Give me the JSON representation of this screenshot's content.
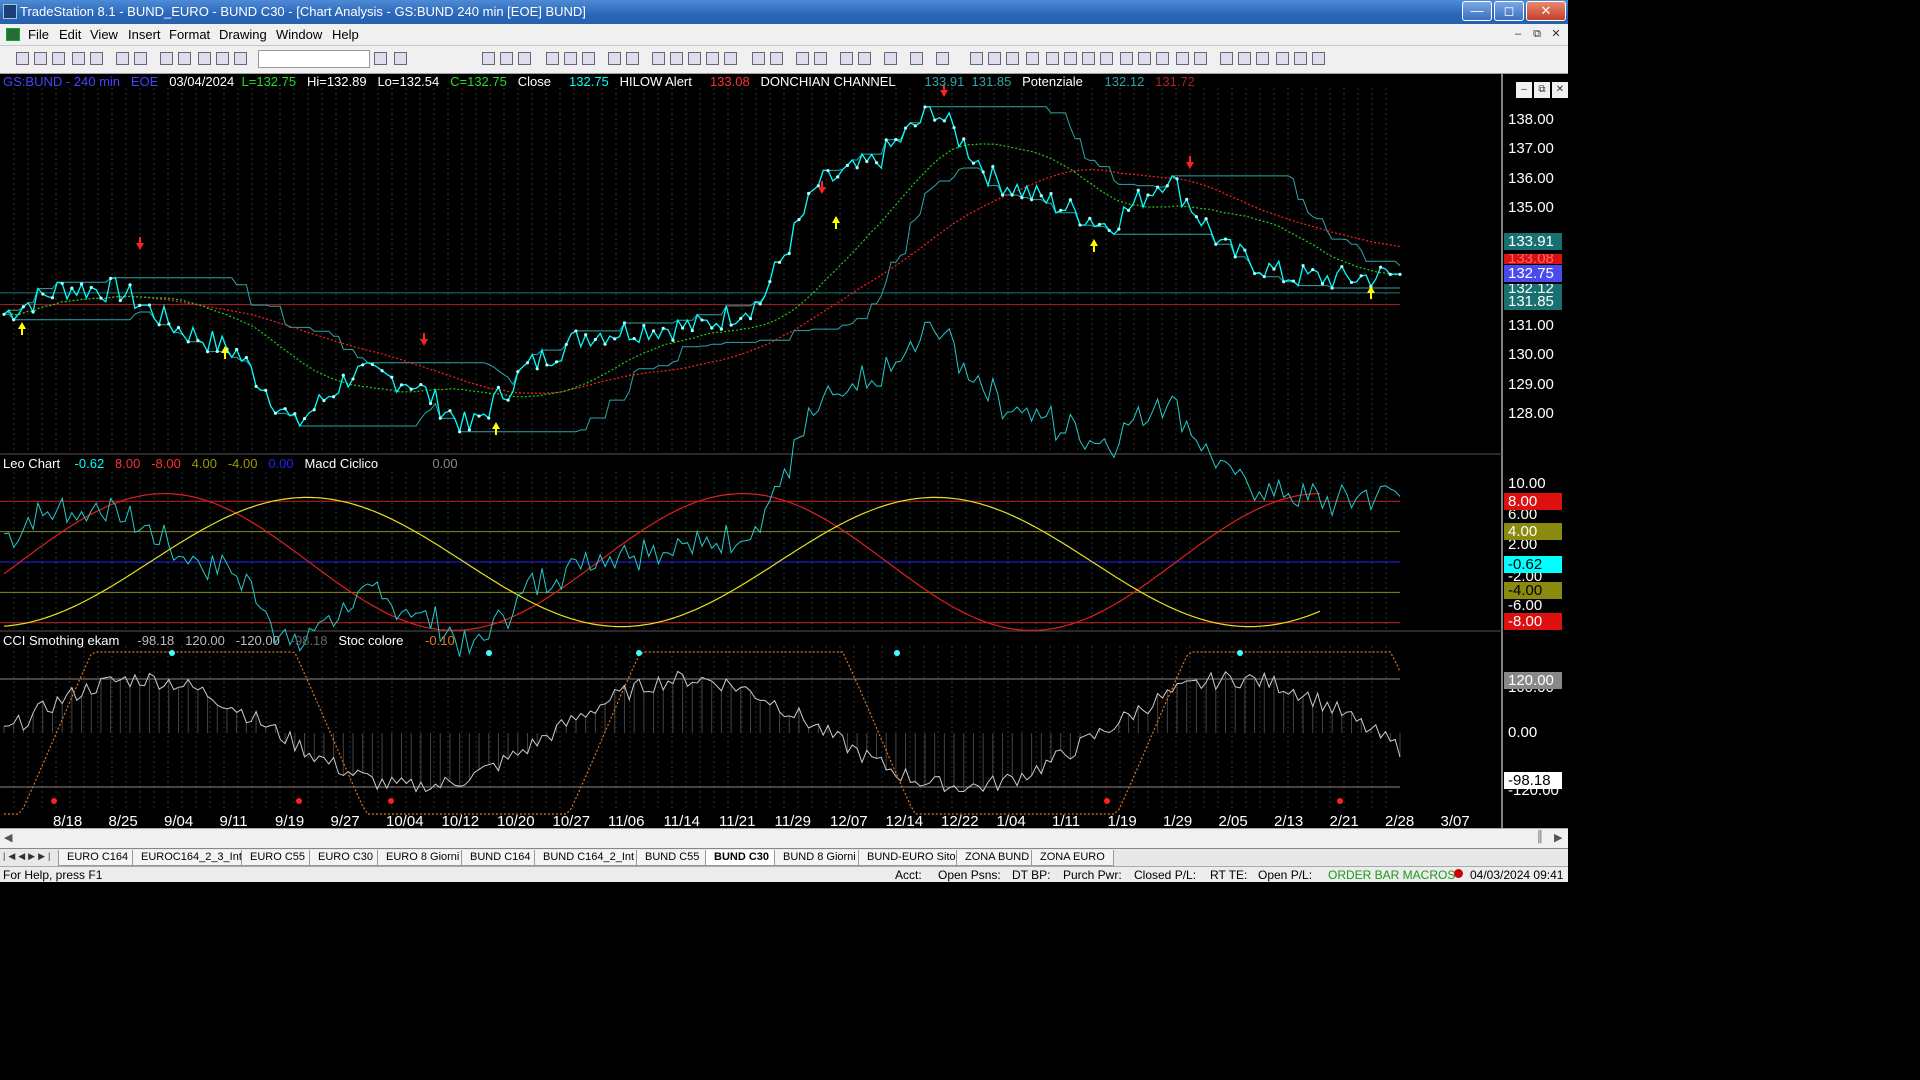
{
  "window": {
    "title": "TradeStation 8.1 - BUND_EURO - BUND  C30 - [Chart Analysis - GS:BUND  240 min  [EOE] BUND]"
  },
  "menu": [
    "File",
    "Edit",
    "View",
    "Insert",
    "Format",
    "Drawing",
    "Window",
    "Help"
  ],
  "header": {
    "symbol": "GS:BUND - 240 min",
    "session": "EOE",
    "date": "03/04/2024",
    "last": "L=132.75",
    "high": "Hi=132.89",
    "low": "Lo=132.54",
    "close": "C=132.75",
    "close_label": "Close",
    "close_val": "132.75",
    "hilow_label": "HILOW Alert",
    "hilow_val": "133.08",
    "donchian_label": "DONCHIAN CHANNEL",
    "donchian_val1": "133.91",
    "donchian_val2": "131.85",
    "pot_label": "Potenziale",
    "pot_val1": "132.12",
    "pot_val2": "131.72"
  },
  "leo": {
    "label": "Leo Chart",
    "v1": "-0.62",
    "v2": "8.00",
    "v3": "-8.00",
    "v4": "4.00",
    "v5": "-4.00",
    "v6": "0.00",
    "macd_label": "Macd Ciclico",
    "macd_val": "0.00"
  },
  "cci": {
    "label": "CCI Smothing ekam",
    "v1": "-98.18",
    "v2": "120.00",
    "v3": "-120.00",
    "v4": "-98.18",
    "stoc_label": "Stoc colore",
    "stoc_val": "-0.10"
  },
  "price_axis": [
    "138.00",
    "137.00",
    "136.00",
    "135.00",
    "131.00",
    "130.00",
    "129.00",
    "128.00"
  ],
  "price_tags": {
    "donchian_hi": "133.91",
    "hilow": "133.08",
    "last": "132.75",
    "pot": "132.12",
    "donchian_lo": "131.85"
  },
  "leo_axis": [
    "10.00",
    "6.00",
    "2.00",
    "-2.00",
    "-6.00"
  ],
  "leo_tags": {
    "t8": "8.00",
    "t4": "4.00",
    "cur": "-0.62",
    "tm4": "-4.00",
    "tm8": "-8.00"
  },
  "cci_axis": [
    "100.00",
    "0.00",
    "-120.00"
  ],
  "cci_tags": {
    "t120": "120.00",
    "cur": "-98.18"
  },
  "dates": [
    "8/18",
    "8/25",
    "9/04",
    "9/11",
    "9/19",
    "9/27",
    "10/04",
    "10/12",
    "10/20",
    "10/27",
    "11/06",
    "11/14",
    "11/21",
    "11/29",
    "12/07",
    "12/14",
    "12/22",
    "1/04",
    "1/11",
    "1/19",
    "1/29",
    "2/05",
    "2/13",
    "2/21",
    "2/28",
    "3/07"
  ],
  "tabs": [
    "EURO C164",
    "EUROC164_2_3_Int",
    "EURO C55",
    "EURO C30",
    "EURO 8 Giorni",
    "BUND C164",
    "BUND C164_2_Int",
    "BUND C55",
    "BUND  C30",
    "BUND 8 Giorni",
    "BUND-EURO Sito",
    "ZONA BUND",
    "ZONA EURO"
  ],
  "active_tab": "BUND  C30",
  "status": {
    "help": "For Help, press F1",
    "acct": "Acct:",
    "open_psns": "Open Psns:",
    "dt_bp": "DT BP:",
    "purch": "Purch Pwr:",
    "closed_pl": "Closed P/L:",
    "rt_te": "RT TE:",
    "open_pl": "Open P/L:",
    "macros": "ORDER BAR  MACROS",
    "clock": "04/03/2024 09:41"
  },
  "colors": {
    "bg": "#000000",
    "close_line": "#00ffff",
    "donchian": "#2aa8a8",
    "red_ma": "#ff2020",
    "green_ma": "#22cc22",
    "yellow": "#ffff00",
    "grey": "#bbbbbb"
  },
  "chart_data": {
    "type": "line",
    "title": "GS:BUND - 240 min",
    "x": [
      "8/18",
      "8/25",
      "9/04",
      "9/11",
      "9/19",
      "9/27",
      "10/04",
      "10/12",
      "10/20",
      "10/27",
      "11/06",
      "11/14",
      "11/21",
      "11/29",
      "12/07",
      "12/14",
      "12/22",
      "1/04",
      "1/11",
      "1/19",
      "1/29",
      "2/05",
      "2/13",
      "2/21",
      "2/28"
    ],
    "series": [
      {
        "name": "Close",
        "values": [
          131.4,
          132.3,
          132.2,
          130.9,
          130.1,
          127.6,
          129.4,
          129.1,
          127.5,
          129.6,
          130.7,
          130.9,
          131.0,
          131.8,
          135.8,
          136.6,
          138.4,
          136.0,
          135.2,
          134.4,
          136.1,
          133.6,
          132.7,
          132.6,
          132.75
        ]
      }
    ],
    "ylim": [
      127.0,
      139.0
    ]
  }
}
